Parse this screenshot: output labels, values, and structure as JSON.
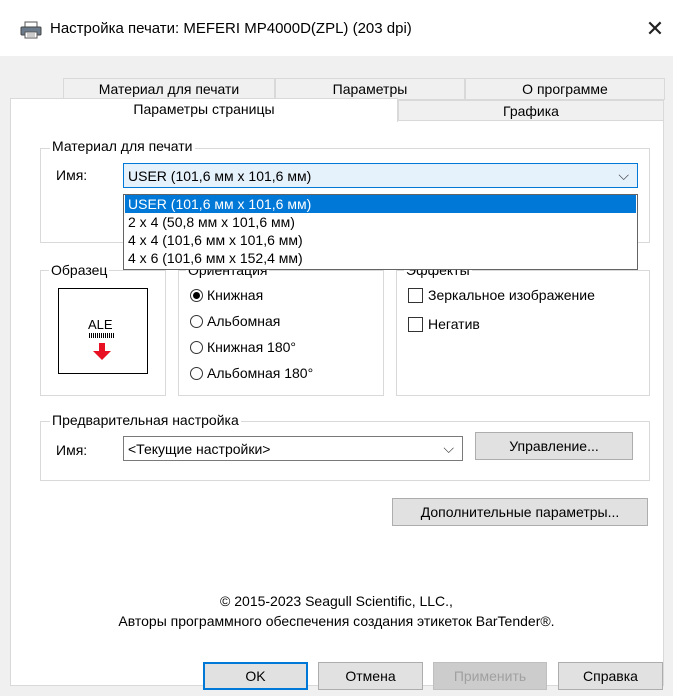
{
  "window": {
    "title": "Настройка печати: MEFERI MP4000D(ZPL) (203 dpi)",
    "close_glyph": "✕"
  },
  "tabs": {
    "row_back": [
      "Материал для печати",
      "Параметры",
      "О программе"
    ],
    "row_front": [
      "Параметры страницы",
      "Графика"
    ]
  },
  "media": {
    "legend": "Материал для печати",
    "name_label": "Имя:",
    "selected": "USER (101,6 мм x 101,6 мм)",
    "options": [
      "USER (101,6 мм x 101,6 мм)",
      "2 x 4 (50,8 мм x 101,6 мм)",
      "4 x 4 (101,6 мм x 101,6 мм)",
      "4 x 6 (101,6 мм x 152,4 мм)"
    ]
  },
  "sample": {
    "legend": "Образец",
    "preview_text": "ALE"
  },
  "orientation": {
    "legend": "Ориентация",
    "options": [
      "Книжная",
      "Альбомная",
      "Книжная 180°",
      "Альбомная 180°"
    ],
    "selected_index": 0
  },
  "effects": {
    "legend": "Эффекты",
    "mirror": "Зеркальное изображение",
    "negative": "Негатив"
  },
  "preset": {
    "legend": "Предварительная настройка",
    "name_label": "Имя:",
    "value": "<Текущие настройки>",
    "manage_button": "Управление..."
  },
  "advanced_button": "Дополнительные параметры...",
  "copyright": {
    "line1": "© 2015-2023 Seagull Scientific, LLC.,",
    "line2": "Авторы программного обеспечения создания этикеток BarTender®."
  },
  "buttons": {
    "ok": "OK",
    "cancel": "Отмена",
    "apply": "Применить",
    "help": "Справка"
  },
  "colors": {
    "accent": "#0078d7",
    "arrow": "#e81123"
  }
}
